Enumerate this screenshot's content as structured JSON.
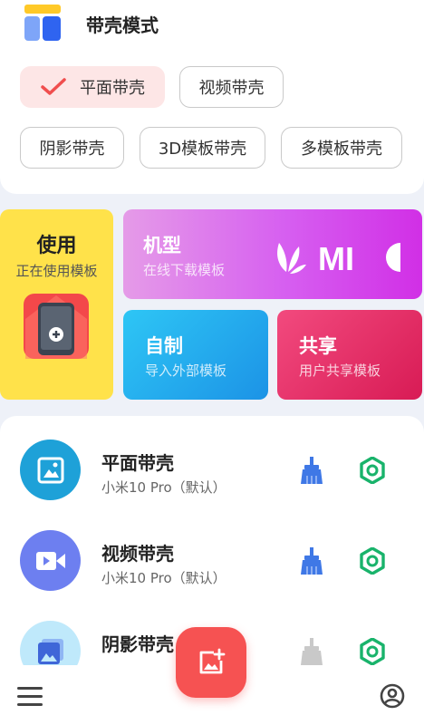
{
  "header": {
    "title": "带壳模式",
    "logo_icon": "layout-icon"
  },
  "modes": [
    {
      "label": "平面带壳",
      "selected": true
    },
    {
      "label": "视频带壳",
      "selected": false
    },
    {
      "label": "阴影带壳",
      "selected": false
    },
    {
      "label": "3D模板带壳",
      "selected": false
    },
    {
      "label": "多模板带壳",
      "selected": false
    }
  ],
  "tiles": {
    "use": {
      "title": "使用",
      "subtitle": "正在使用模板",
      "color": "#ffe24a"
    },
    "model": {
      "title": "机型",
      "subtitle": "在线下载模板",
      "brand_text": "MI"
    },
    "custom": {
      "title": "自制",
      "subtitle": "导入外部模板"
    },
    "share": {
      "title": "共享",
      "subtitle": "用户共享模板"
    }
  },
  "templates": [
    {
      "title": "平面带壳",
      "subtitle": "小米10 Pro（默认）",
      "icon": "image-icon",
      "color": "#1ea1d8",
      "brush_active": true
    },
    {
      "title": "视频带壳",
      "subtitle": "小米10 Pro（默认）",
      "icon": "video-icon",
      "color": "#6d7ff0",
      "brush_active": true
    },
    {
      "title": "阴影带壳",
      "subtitle": "",
      "icon": "shadow-image-icon",
      "color": "#bfe9fb",
      "brush_active": false
    }
  ],
  "colors": {
    "accent": "#f65252",
    "green": "#19b36b",
    "brush_blue": "#3f78e6"
  },
  "bottom_bar": {
    "menu_icon": "menu-icon",
    "profile_icon": "profile-icon",
    "fab_icon": "add-image-icon"
  }
}
